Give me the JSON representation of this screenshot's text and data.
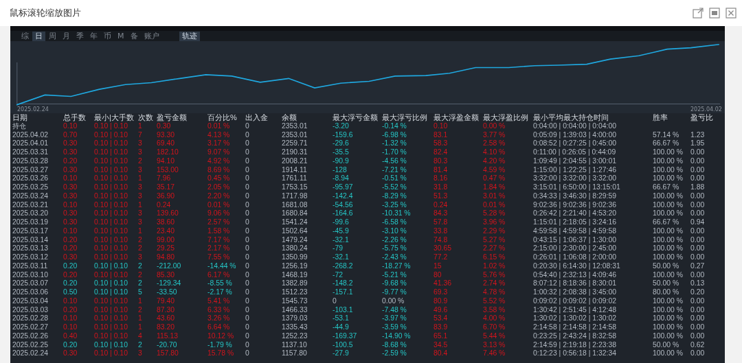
{
  "window": {
    "title": "鼠标滚轮缩放图片"
  },
  "view_tabs": [
    {
      "label": "综",
      "selected": false
    },
    {
      "label": "日",
      "selected": true
    },
    {
      "label": "周",
      "selected": false
    },
    {
      "label": "月",
      "selected": false
    },
    {
      "label": "季",
      "selected": false
    },
    {
      "label": "年",
      "selected": false
    },
    {
      "label": "币",
      "selected": false
    },
    {
      "label": "M",
      "selected": false
    },
    {
      "label": "备",
      "selected": false
    },
    {
      "label": "账户",
      "selected": false
    }
  ],
  "track_button": {
    "label": "轨迹",
    "selected": true
  },
  "chart": {
    "start_label": "2025.02.24",
    "end_label": "2025.04.02"
  },
  "table": {
    "columns": [
      "日期",
      "总手数",
      "最小|大手数",
      "次数",
      "盈亏金额",
      "百分比%",
      "出入金",
      "余额",
      "最大浮亏金额",
      "最大浮亏比例",
      "最大浮盈金额",
      "最大浮盈比例",
      "最小平均最大持仓时间",
      "胜率",
      "盈亏比"
    ],
    "rows": [
      {
        "date": "持仓",
        "lots": "0.10",
        "min_max": "0.10 | 0.10",
        "count": "1",
        "pnl": "0.30",
        "pct": "0.01 %",
        "deposit": "0",
        "balance": "2353.01",
        "mfl": "-3.20",
        "mflp": "-0.14 %",
        "mfp": "0.10",
        "mfpp": "0.00 %",
        "time": "0:04:00 | 0:04:00 | 0:04:00",
        "kind": "profit",
        "drawdown": true
      },
      {
        "date": "2025.04.02",
        "lots": "0.70",
        "min_max": "0.10 | 0.10",
        "count": "7",
        "pnl": "93.30",
        "pct": "4.13 %",
        "deposit": "0",
        "balance": "2353.01",
        "mfl": "-159.6",
        "mflp": "-6.98 %",
        "mfp": "83.1",
        "mfpp": "3.77 %",
        "time": "0:05:09 | 1:39:03 | 4:00:00",
        "win": "57.14 %",
        "ratio": "1.23",
        "kind": "profit",
        "drawdown": true
      },
      {
        "date": "2025.04.01",
        "lots": "0.30",
        "min_max": "0.10 | 0.10",
        "count": "3",
        "pnl": "69.40",
        "pct": "3.17 %",
        "deposit": "0",
        "balance": "2259.71",
        "mfl": "-29.6",
        "mflp": "-1.32 %",
        "mfp": "58.3",
        "mfpp": "2.58 %",
        "time": "0:08:52 | 0:27:25 | 0:45:00",
        "win": "66.67 %",
        "ratio": "1.95",
        "kind": "profit",
        "drawdown": true
      },
      {
        "date": "2025.03.31",
        "lots": "0.30",
        "min_max": "0.10 | 0.10",
        "count": "3",
        "pnl": "182.10",
        "pct": "9.07 %",
        "deposit": "0",
        "balance": "2190.31",
        "mfl": "-35.5",
        "mflp": "-1.70 %",
        "mfp": "82.4",
        "mfpp": "4.10 %",
        "time": "0:11:00 | 0:26:05 | 0:44:09",
        "win": "100.00 %",
        "ratio": "0.00",
        "kind": "profit",
        "drawdown": true
      },
      {
        "date": "2025.03.28",
        "lots": "0.20",
        "min_max": "0.10 | 0.10",
        "count": "2",
        "pnl": "94.10",
        "pct": "4.92 %",
        "deposit": "0",
        "balance": "2008.21",
        "mfl": "-90.9",
        "mflp": "-4.56 %",
        "mfp": "80.3",
        "mfpp": "4.20 %",
        "time": "1:09:49 | 2:04:55 | 3:00:01",
        "win": "100.00 %",
        "ratio": "0.00",
        "kind": "profit",
        "drawdown": true
      },
      {
        "date": "2025.03.27",
        "lots": "0.30",
        "min_max": "0.10 | 0.10",
        "count": "3",
        "pnl": "153.00",
        "pct": "8.69 %",
        "deposit": "0",
        "balance": "1914.11",
        "mfl": "-128",
        "mflp": "-7.21 %",
        "mfp": "81.4",
        "mfpp": "4.59 %",
        "time": "1:15:00 | 1:22:25 | 1:27:46",
        "win": "100.00 %",
        "ratio": "0.00",
        "kind": "profit",
        "drawdown": true
      },
      {
        "date": "2025.03.26",
        "lots": "0.10",
        "min_max": "0.10 | 0.10",
        "count": "1",
        "pnl": "7.96",
        "pct": "0.45 %",
        "deposit": "0",
        "balance": "1761.11",
        "mfl": "-8.94",
        "mflp": "-0.51 %",
        "mfp": "8.16",
        "mfpp": "0.47 %",
        "time": "3:32:00 | 3:32:00 | 3:32:00",
        "win": "100.00 %",
        "ratio": "0.00",
        "kind": "profit",
        "drawdown": true
      },
      {
        "date": "2025.03.25",
        "lots": "0.30",
        "min_max": "0.10 | 0.10",
        "count": "3",
        "pnl": "35.17",
        "pct": "2.05 %",
        "deposit": "0",
        "balance": "1753.15",
        "mfl": "-95.97",
        "mflp": "-5.52 %",
        "mfp": "31.8",
        "mfpp": "1.84 %",
        "time": "3:15:01 | 6:50:00 | 13:15:01",
        "win": "66.67 %",
        "ratio": "1.88",
        "kind": "profit",
        "drawdown": true
      },
      {
        "date": "2025.03.24",
        "lots": "0.30",
        "min_max": "0.10 | 0.10",
        "count": "3",
        "pnl": "36.90",
        "pct": "2.20 %",
        "deposit": "0",
        "balance": "1717.98",
        "mfl": "-142.4",
        "mflp": "-8.29 %",
        "mfp": "51.3",
        "mfpp": "3.01 %",
        "time": "0:34:33 | 3:46:30 | 8:29:59",
        "win": "100.00 %",
        "ratio": "0.00",
        "kind": "profit",
        "drawdown": true
      },
      {
        "date": "2025.03.21",
        "lots": "0.10",
        "min_max": "0.10 | 0.10",
        "count": "1",
        "pnl": "0.24",
        "pct": "0.01 %",
        "deposit": "0",
        "balance": "1681.08",
        "mfl": "-54.56",
        "mflp": "-3.25 %",
        "mfp": "0.24",
        "mfpp": "0.01 %",
        "time": "9:02:36 | 9:02:36 | 9:02:36",
        "win": "100.00 %",
        "ratio": "0.00",
        "kind": "profit",
        "drawdown": true
      },
      {
        "date": "2025.03.20",
        "lots": "0.30",
        "min_max": "0.10 | 0.10",
        "count": "3",
        "pnl": "139.60",
        "pct": "9.06 %",
        "deposit": "0",
        "balance": "1680.84",
        "mfl": "-164.6",
        "mflp": "-10.31 %",
        "mfp": "84.3",
        "mfpp": "5.28 %",
        "time": "0:26:42 | 2:21:40 | 4:53:20",
        "win": "100.00 %",
        "ratio": "0.00",
        "kind": "profit",
        "drawdown": true
      },
      {
        "date": "2025.03.19",
        "lots": "0.30",
        "min_max": "0.10 | 0.10",
        "count": "3",
        "pnl": "38.60",
        "pct": "2.57 %",
        "deposit": "0",
        "balance": "1541.24",
        "mfl": "-99.6",
        "mflp": "-6.58 %",
        "mfp": "57.8",
        "mfpp": "3.96 %",
        "time": "1:15:01 | 2:18:05 | 3:24:16",
        "win": "66.67 %",
        "ratio": "0.94",
        "kind": "profit",
        "drawdown": true
      },
      {
        "date": "2025.03.17",
        "lots": "0.10",
        "min_max": "0.10 | 0.10",
        "count": "1",
        "pnl": "23.40",
        "pct": "1.58 %",
        "deposit": "0",
        "balance": "1502.64",
        "mfl": "-45.9",
        "mflp": "-3.10 %",
        "mfp": "33.8",
        "mfpp": "2.29 %",
        "time": "4:59:58 | 4:59:58 | 4:59:58",
        "win": "100.00 %",
        "ratio": "0.00",
        "kind": "profit",
        "drawdown": true
      },
      {
        "date": "2025.03.14",
        "lots": "0.20",
        "min_max": "0.10 | 0.10",
        "count": "2",
        "pnl": "99.00",
        "pct": "7.17 %",
        "deposit": "0",
        "balance": "1479.24",
        "mfl": "-32.1",
        "mflp": "-2.26 %",
        "mfp": "74.8",
        "mfpp": "5.27 %",
        "time": "0:43:15 | 1:06:37 | 1:30:00",
        "win": "100.00 %",
        "ratio": "0.00",
        "kind": "profit",
        "drawdown": true
      },
      {
        "date": "2025.03.13",
        "lots": "0.20",
        "min_max": "0.10 | 0.10",
        "count": "2",
        "pnl": "29.25",
        "pct": "2.17 %",
        "deposit": "0",
        "balance": "1380.24",
        "mfl": "-79",
        "mflp": "-5.75 %",
        "mfp": "30.65",
        "mfpp": "2.27 %",
        "time": "2:15:00 | 2:30:00 | 2:45:00",
        "win": "100.00 %",
        "ratio": "0.00",
        "kind": "profit",
        "drawdown": true
      },
      {
        "date": "2025.03.12",
        "lots": "0.30",
        "min_max": "0.10 | 0.10",
        "count": "3",
        "pnl": "94.80",
        "pct": "7.55 %",
        "deposit": "0",
        "balance": "1350.99",
        "mfl": "-32.1",
        "mflp": "-2.43 %",
        "mfp": "77.2",
        "mfpp": "6.15 %",
        "time": "0:26:01 | 1:06:08 | 2:00:00",
        "win": "100.00 %",
        "ratio": "0.00",
        "kind": "profit",
        "drawdown": true
      },
      {
        "date": "2025.03.11",
        "lots": "0.20",
        "min_max": "0.10 | 0.10",
        "count": "2",
        "pnl": "-212.00",
        "pct": "-14.44 %",
        "deposit": "0",
        "balance": "1256.19",
        "mfl": "-268.2",
        "mflp": "-18.27 %",
        "mfp": "15",
        "mfpp": "1.02 %",
        "time": "0:20:30 | 6:14:30 | 12:08:31",
        "win": "50.00 %",
        "ratio": "0.27",
        "kind": "loss",
        "drawdown": true
      },
      {
        "date": "2025.03.10",
        "lots": "0.20",
        "min_max": "0.10 | 0.10",
        "count": "2",
        "pnl": "85.30",
        "pct": "6.17 %",
        "deposit": "0",
        "balance": "1468.19",
        "mfl": "-72",
        "mflp": "-5.21 %",
        "mfp": "80",
        "mfpp": "5.76 %",
        "time": "0:54:40 | 2:32:13 | 4:09:46",
        "win": "100.00 %",
        "ratio": "0.00",
        "kind": "profit",
        "drawdown": true
      },
      {
        "date": "2025.03.07",
        "lots": "0.20",
        "min_max": "0.10 | 0.10",
        "count": "2",
        "pnl": "-129.34",
        "pct": "-8.55 %",
        "deposit": "0",
        "balance": "1382.89",
        "mfl": "-148.2",
        "mflp": "-9.68 %",
        "mfp": "41.36",
        "mfpp": "2.74 %",
        "time": "8:07:12 | 8:18:36 | 8:30:01",
        "win": "50.00 %",
        "ratio": "0.13",
        "kind": "loss",
        "drawdown": true
      },
      {
        "date": "2025.03.06",
        "lots": "0.50",
        "min_max": "0.10 | 0.10",
        "count": "5",
        "pnl": "-33.50",
        "pct": "-2.17 %",
        "deposit": "0",
        "balance": "1512.23",
        "mfl": "-157.1",
        "mflp": "-9.77 %",
        "mfp": "69.3",
        "mfpp": "4.78 %",
        "time": "1:00:32 | 2:08:38 | 3:45:00",
        "win": "80.00 %",
        "ratio": "0.20",
        "kind": "loss",
        "drawdown": true
      },
      {
        "date": "2025.03.04",
        "lots": "0.10",
        "min_max": "0.10 | 0.10",
        "count": "1",
        "pnl": "79.40",
        "pct": "5.41 %",
        "deposit": "0",
        "balance": "1545.73",
        "mfl": "0",
        "mflp": "0.00 %",
        "mfp": "80.9",
        "mfpp": "5.52 %",
        "time": "0:09:02 | 0:09:02 | 0:09:02",
        "win": "100.00 %",
        "ratio": "0.00",
        "kind": "profit",
        "drawdown": false
      },
      {
        "date": "2025.03.03",
        "lots": "0.20",
        "min_max": "0.10 | 0.10",
        "count": "2",
        "pnl": "87.30",
        "pct": "6.33 %",
        "deposit": "0",
        "balance": "1466.33",
        "mfl": "-103.1",
        "mflp": "-7.48 %",
        "mfp": "49.6",
        "mfpp": "3.58 %",
        "time": "1:30:42 | 2:51:45 | 4:12:48",
        "win": "100.00 %",
        "ratio": "0.00",
        "kind": "profit",
        "drawdown": true
      },
      {
        "date": "2025.02.28",
        "lots": "0.10",
        "min_max": "0.10 | 0.10",
        "count": "1",
        "pnl": "43.60",
        "pct": "3.26 %",
        "deposit": "0",
        "balance": "1379.03",
        "mfl": "-53.1",
        "mflp": "-3.97 %",
        "mfp": "53.4",
        "mfpp": "4.00 %",
        "time": "1:30:02 | 1:30:02 | 1:30:02",
        "win": "100.00 %",
        "ratio": "0.00",
        "kind": "profit",
        "drawdown": true
      },
      {
        "date": "2025.02.27",
        "lots": "0.10",
        "min_max": "0.10 | 0.10",
        "count": "1",
        "pnl": "83.20",
        "pct": "6.64 %",
        "deposit": "0",
        "balance": "1335.43",
        "mfl": "-44.9",
        "mflp": "-3.59 %",
        "mfp": "83.9",
        "mfpp": "6.70 %",
        "time": "2:14:58 | 2:14:58 | 2:14:58",
        "win": "100.00 %",
        "ratio": "0.00",
        "kind": "profit",
        "drawdown": true
      },
      {
        "date": "2025.02.26",
        "lots": "0.40",
        "min_max": "0.10 | 0.10",
        "count": "4",
        "pnl": "115.13",
        "pct": "10.12 %",
        "deposit": "0",
        "balance": "1252.23",
        "mfl": "-169.37",
        "mflp": "-14.90 %",
        "mfp": "65.1",
        "mfpp": "5.44 %",
        "time": "0:23:25 | 2:43:24 | 8:32:58",
        "win": "100.00 %",
        "ratio": "0.00",
        "kind": "profit",
        "drawdown": true
      },
      {
        "date": "2025.02.25",
        "lots": "0.20",
        "min_max": "0.10 | 0.10",
        "count": "2",
        "pnl": "-20.70",
        "pct": "-1.79 %",
        "deposit": "0",
        "balance": "1137.10",
        "mfl": "-100.5",
        "mflp": "-8.68 %",
        "mfp": "34.5",
        "mfpp": "3.13 %",
        "time": "2:14:59 | 2:19:18 | 2:23:38",
        "win": "50.00 %",
        "ratio": "0.62",
        "kind": "loss",
        "drawdown": true
      },
      {
        "date": "2025.02.24",
        "lots": "0.30",
        "min_max": "0.10 | 0.10",
        "count": "3",
        "pnl": "157.80",
        "pct": "15.78 %",
        "deposit": "0",
        "balance": "1157.80",
        "mfl": "-27.9",
        "mflp": "-2.59 %",
        "mfp": "80.4",
        "mfpp": "7.46 %",
        "time": "0:12:23 | 0:56:18 | 1:32:34",
        "win": "100.00 %",
        "ratio": "0.00",
        "kind": "profit",
        "drawdown": true
      }
    ]
  }
}
